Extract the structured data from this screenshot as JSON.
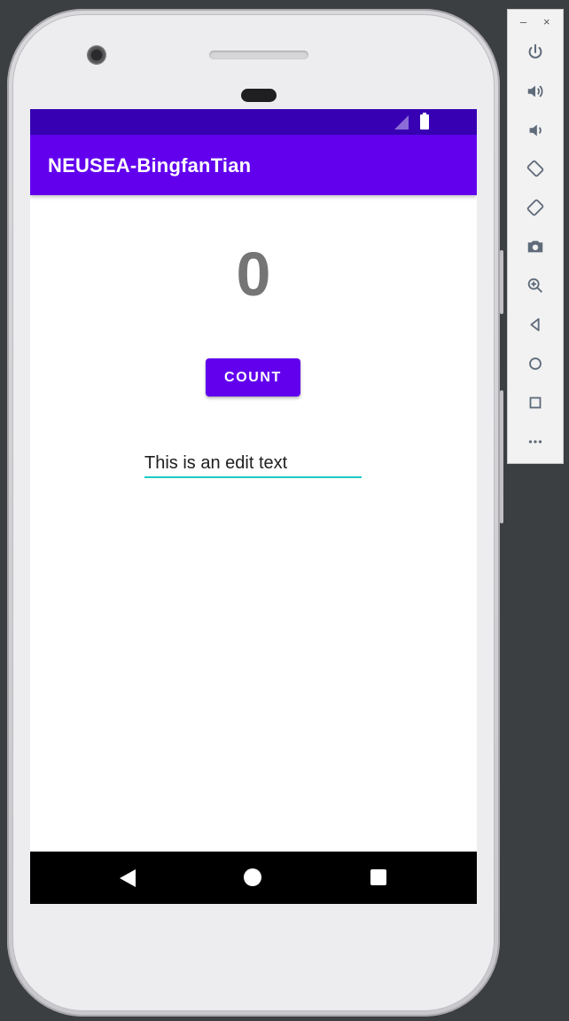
{
  "app": {
    "title": "NEUSEA-BingfanTian",
    "count_value": "0",
    "count_button_label": "COUNT",
    "edit_text_value": "This is an edit text"
  },
  "colors": {
    "status_bar": "#3700b3",
    "app_bar": "#6200ee",
    "button": "#6200ee",
    "edit_underline": "#1ccbc4",
    "count_text": "#757575"
  },
  "emulator_toolbar": {
    "window_controls": [
      "–",
      "×"
    ],
    "tools": [
      "power-icon",
      "volume-up-icon",
      "volume-down-icon",
      "rotate-left-icon",
      "rotate-right-icon",
      "camera-icon",
      "zoom-icon",
      "back-icon",
      "home-icon",
      "overview-icon",
      "more-icon"
    ]
  }
}
